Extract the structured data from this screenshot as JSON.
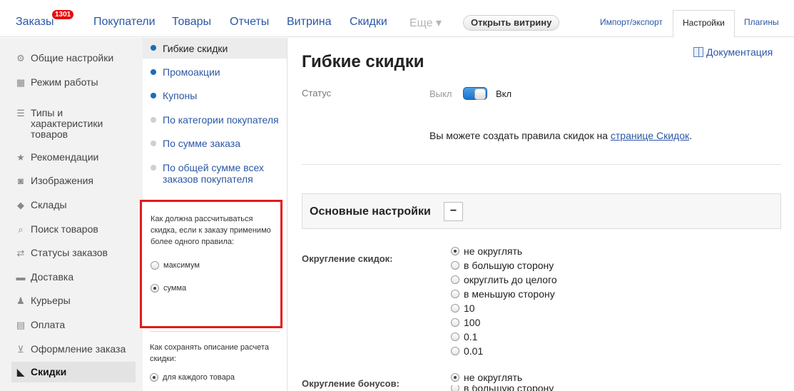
{
  "topnav": {
    "orders_label": "Заказы",
    "orders_badge": "1301",
    "customers_label": "Покупатели",
    "products_label": "Товары",
    "reports_label": "Отчеты",
    "storefront_label": "Витрина",
    "discounts_label": "Скидки",
    "more_label": "Еще ▾",
    "open_storefront_label": "Открыть витрину",
    "import_export_label": "Импорт/экспорт",
    "settings_label": "Настройки",
    "plugins_label": "Плагины"
  },
  "sidebar": {
    "items": [
      {
        "label": "Общие настройки",
        "icon": "gears-icon"
      },
      {
        "label": "Режим работы",
        "icon": "calendar-icon"
      },
      {
        "label": "Типы и характеристики товаров",
        "icon": "list-icon"
      },
      {
        "label": "Рекомендации",
        "icon": "star-icon"
      },
      {
        "label": "Изображения",
        "icon": "camera-icon"
      },
      {
        "label": "Склады",
        "icon": "box-icon"
      },
      {
        "label": "Поиск товаров",
        "icon": "search-icon"
      },
      {
        "label": "Статусы заказов",
        "icon": "workflow-icon"
      },
      {
        "label": "Доставка",
        "icon": "truck-icon"
      },
      {
        "label": "Курьеры",
        "icon": "runner-icon"
      },
      {
        "label": "Оплата",
        "icon": "wallet-icon"
      },
      {
        "label": "Оформление заказа",
        "icon": "cart-icon"
      },
      {
        "label": "Скидки",
        "icon": "tag-icon"
      }
    ]
  },
  "discount_types": {
    "items": [
      {
        "label": "Гибкие скидки",
        "enabled": true
      },
      {
        "label": "Промоакции",
        "enabled": true
      },
      {
        "label": "Купоны",
        "enabled": true
      },
      {
        "label": "По категории покупателя",
        "enabled": false
      },
      {
        "label": "По сумме заказа",
        "enabled": false
      },
      {
        "label": "По общей сумме всех заказов покупателя",
        "enabled": false
      }
    ],
    "calc_question": "Как должна рассчитываться скидка, если к заказу применимо более одного правила:",
    "calc_options": [
      "максимум",
      "сумма"
    ],
    "calc_selected": "сумма",
    "save_question": "Как сохранять описание расчета скидки:",
    "save_option": "для каждого товара"
  },
  "main": {
    "title": "Гибкие скидки",
    "doc_link": "Документация",
    "status_label": "Статус",
    "status_off": "Выкл",
    "status_on": "Вкл",
    "status_value": true,
    "info_text": "Вы можете создать правила скидок на ",
    "info_link": "странице Скидок",
    "info_suffix": ".",
    "section_title": "Основные настройки",
    "collapse_label": "−",
    "rounding_label": "Округление скидок:",
    "rounding_options": [
      "не округлять",
      "в большую сторону",
      "округлить до целого",
      "в меньшую сторону",
      "10",
      "100",
      "0.1",
      "0.01"
    ],
    "rounding_selected": "не округлять",
    "bonus_label": "Округление бонусов:",
    "bonus_options": [
      "не округлять",
      "в большую сторону"
    ],
    "bonus_selected": "не округлять"
  }
}
